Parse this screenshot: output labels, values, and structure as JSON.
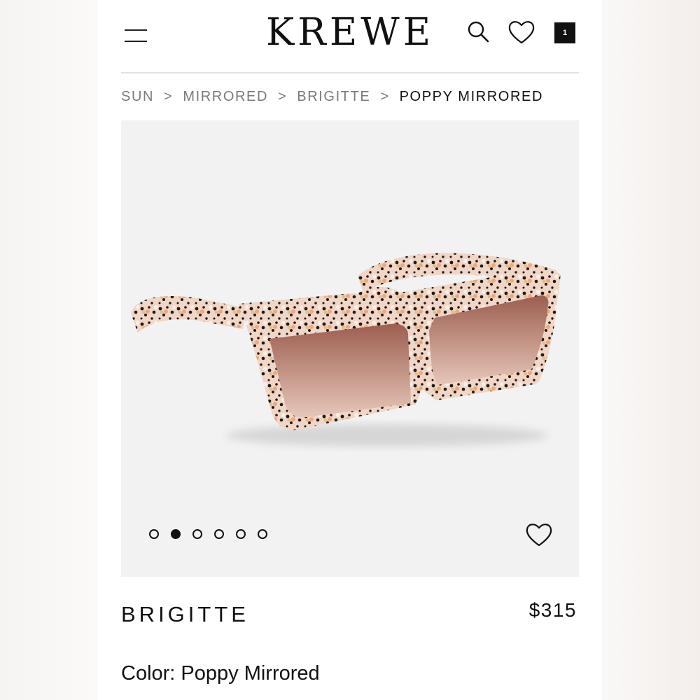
{
  "header": {
    "logo": "KREWE",
    "cart_count": "1",
    "icons": [
      "menu-icon",
      "search-icon",
      "heart-icon",
      "shopping-bag-icon"
    ]
  },
  "breadcrumb": {
    "items": [
      "SUN",
      "MIRRORED",
      "BRIGITTE"
    ],
    "separator": ">",
    "current": "POPPY MIRRORED"
  },
  "gallery": {
    "image_count": 6,
    "active_index": 1,
    "favorite_icon": "heart-outline-icon"
  },
  "product": {
    "name": "BRIGITTE",
    "price": "$315",
    "color_line": "Color: Poppy Mirrored"
  },
  "colors": {
    "text": "#111111",
    "muted": "#7a7a7a",
    "gallery_bg": "#f2f2f2",
    "frame_base": "#f3d9c8",
    "lens": "#a86e5e"
  }
}
